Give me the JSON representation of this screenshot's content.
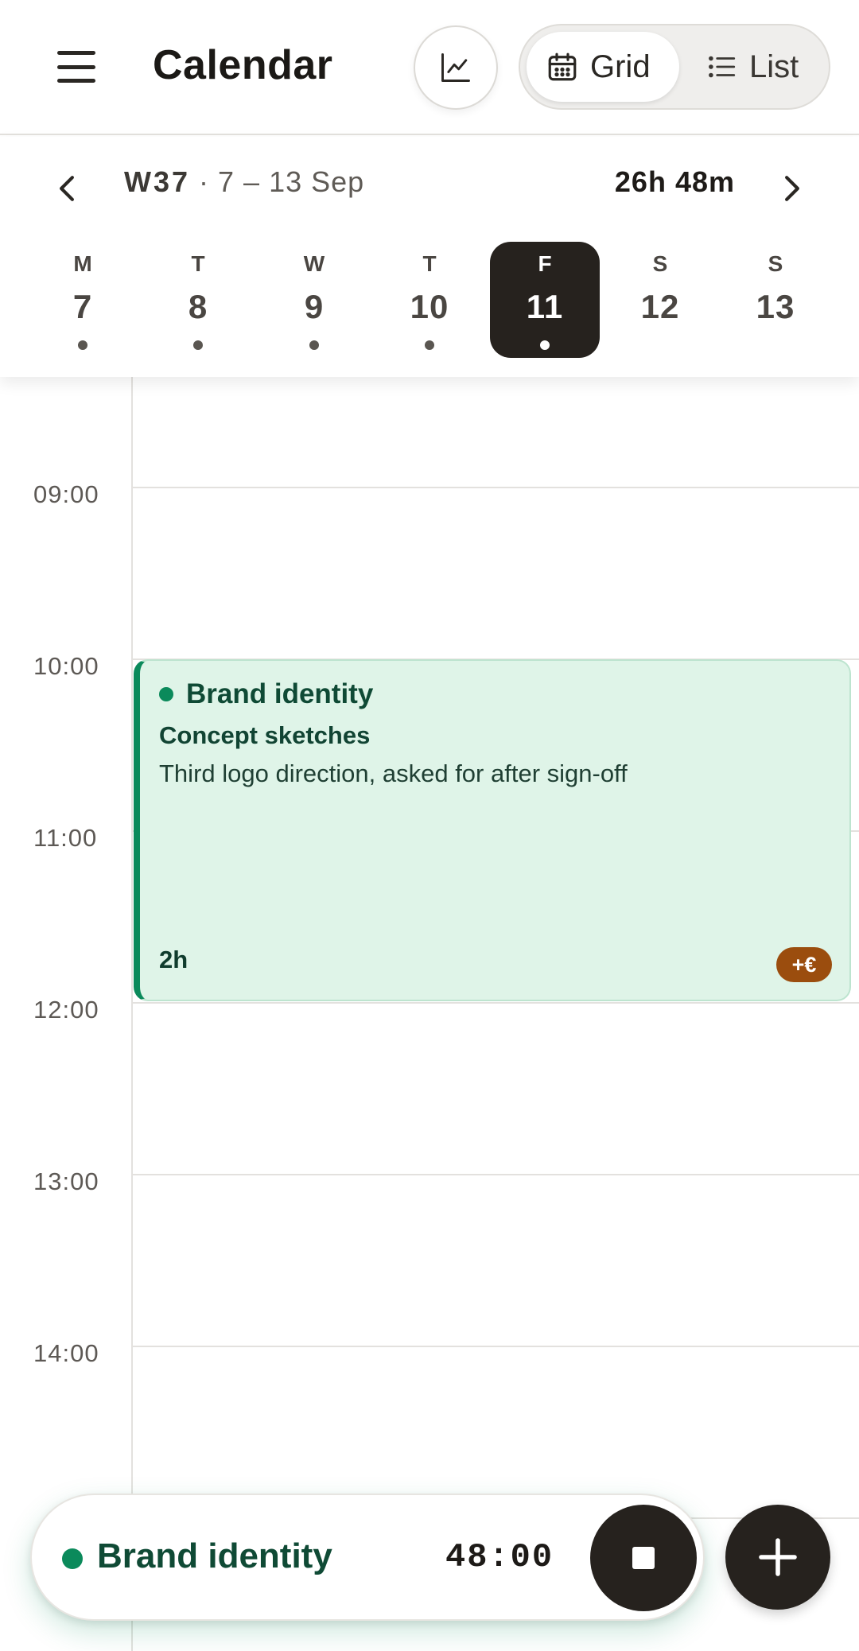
{
  "header": {
    "title": "Calendar",
    "menu_icon": "hamburger-menu-icon",
    "stats_icon": "line-chart-icon",
    "view_toggle": {
      "selected": "Grid",
      "options": [
        {
          "label": "Grid",
          "icon": "calendar-grid-icon"
        },
        {
          "label": "List",
          "icon": "list-icon"
        }
      ]
    }
  },
  "week": {
    "week_number": "W37",
    "date_range": "· 7 – 13 Sep",
    "total": "26h 48m",
    "days": [
      {
        "letter": "M",
        "number": "7",
        "has_entries": true,
        "selected": false
      },
      {
        "letter": "T",
        "number": "8",
        "has_entries": true,
        "selected": false
      },
      {
        "letter": "W",
        "number": "9",
        "has_entries": true,
        "selected": false
      },
      {
        "letter": "T",
        "number": "10",
        "has_entries": true,
        "selected": false
      },
      {
        "letter": "F",
        "number": "11",
        "has_entries": true,
        "selected": true
      },
      {
        "letter": "S",
        "number": "12",
        "has_entries": false,
        "selected": false
      },
      {
        "letter": "S",
        "number": "13",
        "has_entries": false,
        "selected": false
      }
    ]
  },
  "timeline": {
    "hours": [
      "09:00",
      "10:00",
      "11:00",
      "12:00",
      "13:00",
      "14:00"
    ]
  },
  "event": {
    "project": "Brand identity",
    "task": "Concept sketches",
    "description": "Third logo direction, asked for after sign-off",
    "duration": "2h",
    "badge": "+€",
    "start": "10:00",
    "end": "12:00",
    "color": "#0b8a5b"
  },
  "timer": {
    "project": "Brand identity",
    "elapsed": "48:00",
    "stop_icon": "stop-icon",
    "add_icon": "plus-icon"
  },
  "colors": {
    "accent": "#0b8a5b",
    "event_bg": "#dff4e8",
    "badge": "#9b4d0e",
    "dark": "#26221e"
  }
}
